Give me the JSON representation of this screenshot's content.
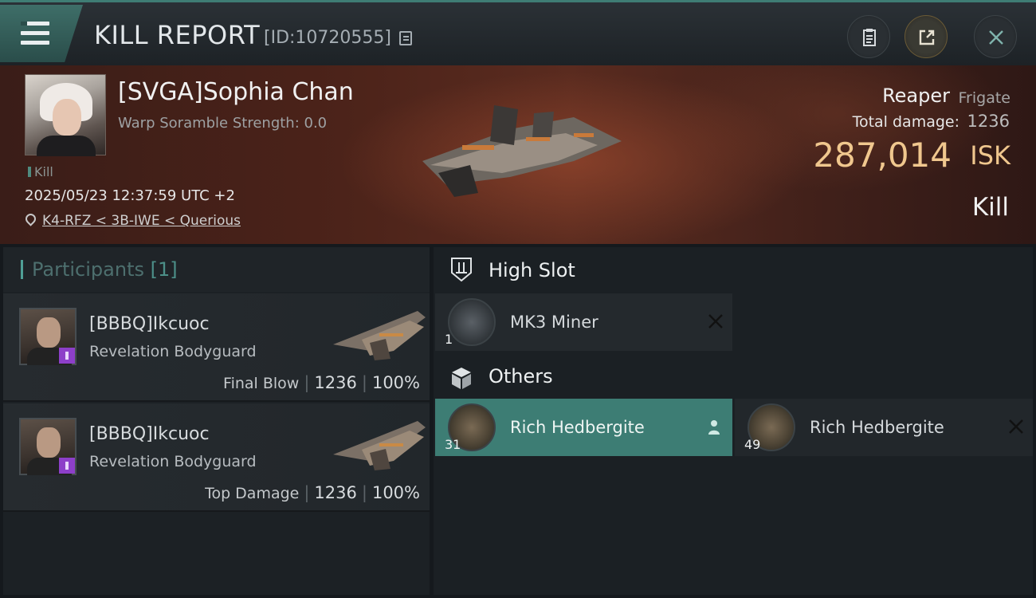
{
  "header": {
    "title": "KILL REPORT",
    "report_id": "[ID:10720555]"
  },
  "victim": {
    "name": "[SVGA]Sophia Chan",
    "scramble": "Warp Soramble Strength: 0.0",
    "tag": "Kill",
    "timestamp": "2025/05/23 12:37:59 UTC +2",
    "location": "K4-RFZ < 3B-IWE < Querious",
    "ship_name": "Reaper",
    "ship_class": "Frigate",
    "damage_label": "Total damage:",
    "damage_value": "1236",
    "isk_value": "287,014",
    "isk_unit": "ISK",
    "result": "Kill"
  },
  "participants": {
    "title": "Participants",
    "count": "[1]",
    "rows": [
      {
        "name": "[BBBQ]Ikcuoc",
        "ship": "Revelation Bodyguard",
        "label": "Final Blow",
        "damage": "1236",
        "percent": "100%"
      },
      {
        "name": "[BBBQ]Ikcuoc",
        "ship": "Revelation Bodyguard",
        "label": "Top Damage",
        "damage": "1236",
        "percent": "100%"
      }
    ]
  },
  "items": {
    "high_slot_title": "High Slot",
    "others_title": "Others",
    "high_slot": [
      {
        "qty": "1",
        "name": "MK3 Miner"
      }
    ],
    "others": [
      {
        "qty": "31",
        "name": "Rich Hedbergite"
      },
      {
        "qty": "49",
        "name": "Rich Hedbergite"
      }
    ]
  },
  "colors": {
    "accent": "#3d7d74",
    "isk": "#f0c78e",
    "badge": "#8d3fc9"
  }
}
